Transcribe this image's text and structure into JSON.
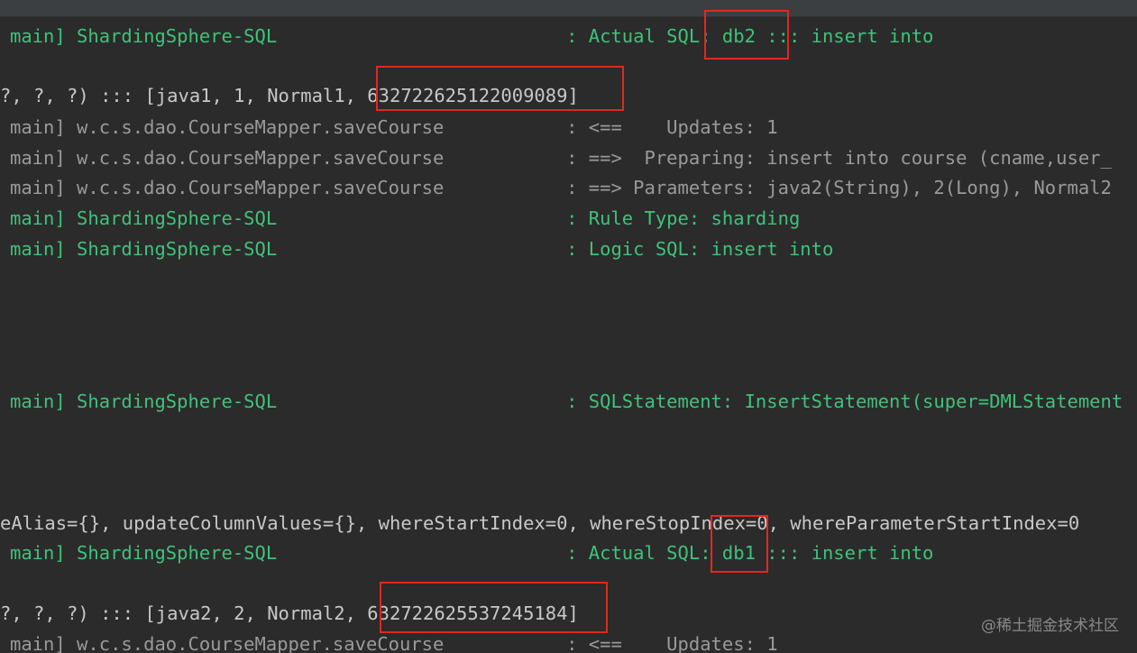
{
  "lines": [
    "main] ShardingSphere-SQL                          : Actual SQL: db2 ::: insert into",
    "?, ?, ?) ::: [java1, 1, Normal1, 632722625122009089]",
    "main] w.c.s.dao.CourseMapper.saveCourse           : <==    Updates: 1",
    "main] w.c.s.dao.CourseMapper.saveCourse           : ==>  Preparing: insert into course (cname,user_",
    "main] w.c.s.dao.CourseMapper.saveCourse           : ==> Parameters: java2(String), 2(Long), Normal2",
    "main] ShardingSphere-SQL                          : Rule Type: sharding",
    "main] ShardingSphere-SQL                          : Logic SQL: insert into",
    "main] ShardingSphere-SQL                          : SQLStatement: InsertStatement(super=DMLStatement",
    "eAlias={}, updateColumnValues={}, whereStartIndex=0, whereStopIndex=0, whereParameterStartIndex=0",
    "main] ShardingSphere-SQL                          : Actual SQL: db1 ::: insert into",
    "?, ?, ?) ::: [java2, 2, Normal2, 632722625537245184]",
    "main] w.c.s.dao.CourseMapper.saveCourse           : <==    Updates: 1"
  ],
  "watermark": "@稀土掘金技术社区"
}
